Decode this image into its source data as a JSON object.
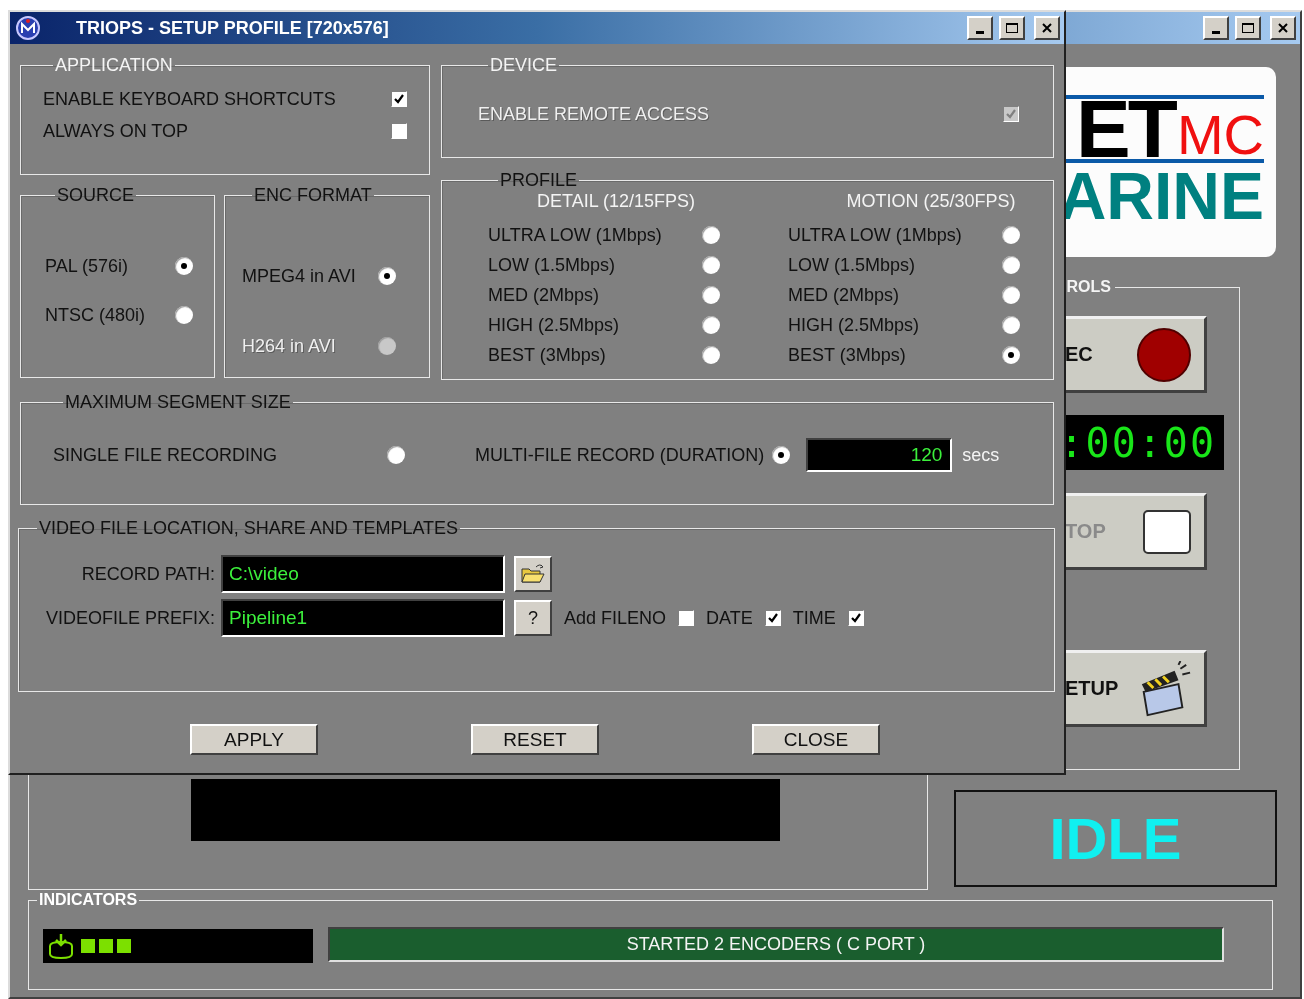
{
  "main_window": {
    "logo": {
      "text": "ET",
      "suffix": "MC",
      "line2": "ARINE"
    },
    "controls": {
      "title": "ROLS",
      "buttons": [
        {
          "kind": "rec",
          "label": "EC",
          "disabled": false
        },
        {
          "kind": "timer",
          "label": ":00:00",
          "disabled": false
        },
        {
          "kind": "stop",
          "label": "TOP",
          "disabled": true
        },
        {
          "kind": "setup",
          "label": "ETUP",
          "disabled": false
        }
      ]
    },
    "status": "IDLE",
    "indicators": {
      "title": "INDICATORS",
      "message": "STARTED 2 ENCODERS ( C PORT )"
    }
  },
  "dialog": {
    "title": "TRIOPS - SETUP PROFILE [720x576]",
    "application": {
      "title": "APPLICATION",
      "options": [
        {
          "label": "ENABLE KEYBOARD SHORTCUTS",
          "checked": true,
          "disabled": false
        },
        {
          "label": "ALWAYS ON TOP",
          "checked": false,
          "disabled": false
        }
      ]
    },
    "device": {
      "title": "DEVICE",
      "options": [
        {
          "label": "ENABLE REMOTE ACCESS",
          "checked": true,
          "disabled": true
        }
      ]
    },
    "source": {
      "title": "SOURCE",
      "options": [
        {
          "label": "PAL (576i)",
          "selected": true,
          "disabled": false
        },
        {
          "label": "NTSC (480i)",
          "selected": false,
          "disabled": false
        }
      ]
    },
    "enc_format": {
      "title": "ENC FORMAT",
      "options": [
        {
          "label": "MPEG4 in AVI",
          "selected": true,
          "disabled": false
        },
        {
          "label": "H264 in AVI",
          "selected": false,
          "disabled": true
        }
      ]
    },
    "profile": {
      "title": "PROFILE",
      "columns": [
        {
          "heading": "DETAIL (12/15FPS)",
          "options": [
            {
              "label": "ULTRA LOW (1Mbps)",
              "selected": false
            },
            {
              "label": "LOW (1.5Mbps)",
              "selected": false
            },
            {
              "label": "MED (2Mbps)",
              "selected": false
            },
            {
              "label": "HIGH (2.5Mbps)",
              "selected": false
            },
            {
              "label": "BEST (3Mbps)",
              "selected": false
            }
          ]
        },
        {
          "heading": "MOTION (25/30FPS)",
          "options": [
            {
              "label": "ULTRA LOW (1Mbps)",
              "selected": false
            },
            {
              "label": "LOW (1.5Mbps)",
              "selected": false
            },
            {
              "label": "MED (2Mbps)",
              "selected": false
            },
            {
              "label": "HIGH (2.5Mbps)",
              "selected": false
            },
            {
              "label": "BEST (3Mbps)",
              "selected": true
            }
          ]
        }
      ]
    },
    "segment": {
      "title": "MAXIMUM SEGMENT SIZE",
      "options": [
        {
          "label": "SINGLE FILE RECORDING",
          "selected": false
        },
        {
          "label": "MULTI-FILE RECORD (DURATION)",
          "selected": true
        }
      ],
      "duration": "120",
      "unit": "secs"
    },
    "file_location": {
      "title": "VIDEO FILE LOCATION, SHARE AND TEMPLATES",
      "record_path": {
        "label": "RECORD PATH:",
        "value": "C:\\video"
      },
      "prefix": {
        "label": "VIDEOFILE PREFIX:",
        "value": "Pipeline1",
        "help": "?"
      },
      "flags": [
        {
          "label": "Add FILENO",
          "checked": false
        },
        {
          "label": "DATE",
          "checked": true
        },
        {
          "label": "TIME",
          "checked": true
        }
      ]
    },
    "buttons": [
      "APPLY",
      "RESET",
      "CLOSE"
    ]
  }
}
